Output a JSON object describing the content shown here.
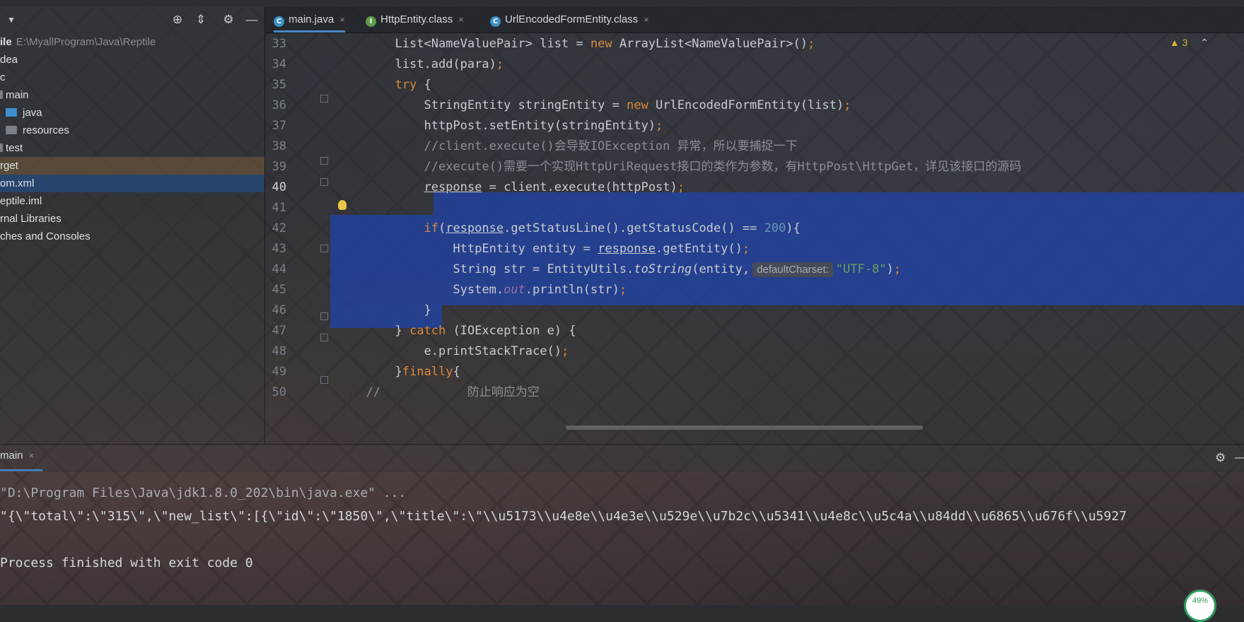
{
  "project": {
    "root_name": "ile",
    "root_path": "E:\\MyallProgram\\Java\\Reptile",
    "items": [
      {
        "label": "dea"
      },
      {
        "label": "c"
      },
      {
        "label": "main"
      },
      {
        "label": "java"
      },
      {
        "label": "resources"
      },
      {
        "label": "test"
      },
      {
        "label": "rget"
      },
      {
        "label": "om.xml"
      },
      {
        "label": "eptile.iml"
      },
      {
        "label": "rnal Libraries"
      },
      {
        "label": "ches and Consoles"
      }
    ]
  },
  "tabs": [
    {
      "label": "main.java",
      "icon": "C",
      "close": "×"
    },
    {
      "label": "HttpEntity.class",
      "icon": "I",
      "close": "×"
    },
    {
      "label": "UrlEncodedFormEntity.class",
      "icon": "C",
      "close": "×"
    }
  ],
  "editor": {
    "warning_count": "3",
    "lines": {
      "n33": "33",
      "n34": "34",
      "n35": "35",
      "n36": "36",
      "n37": "37",
      "n38": "38",
      "n39": "39",
      "n40": "40",
      "n41": "41",
      "n42": "42",
      "n43": "43",
      "n44": "44",
      "n45": "45",
      "n46": "46",
      "n47": "47",
      "n48": "48",
      "n49": "49",
      "n50": "50"
    },
    "code": {
      "l33a": "List<NameValuePair> list = ",
      "l33b": "new",
      "l33c": " ArrayList<NameValuePair>()",
      "l33d": ";",
      "l34a": "list.add(para)",
      "l34b": ";",
      "l35a": "try",
      "l35b": " {",
      "l36a": "StringEntity stringEntity = ",
      "l36b": "new",
      "l36c": " UrlEncodedFormEntity(list)",
      "l36d": ";",
      "l37a": "httpPost.setEntity(stringEntity)",
      "l37b": ";",
      "l38": "//client.execute()会导致IOException 异常，所以要捕捉一下",
      "l39": "//execute()需要一个实现HttpUriRequest接口的类作为参数，有HttpPost\\HttpGet，详见该接口的源码",
      "l40a": "response",
      "l40b": " = client.execute(httpPost)",
      "l40c": ";",
      "l42a": "if",
      "l42b": "(",
      "l42c": "response",
      "l42d": ".getStatusLine().getStatusCode() == ",
      "l42e": "200",
      "l42f": "){",
      "l43a": "HttpEntity entity = ",
      "l43b": "response",
      "l43c": ".getEntity()",
      "l43d": ";",
      "l44a": "String str = EntityUtils.",
      "l44b": "toString",
      "l44c": "(entity,",
      "l44hint": "defaultCharset:",
      "l44d": "\"UTF-8\"",
      "l44e": ")",
      "l44f": ";",
      "l45a": "System.",
      "l45b": "out",
      "l45c": ".println(str)",
      "l45d": ";",
      "l46": "}",
      "l47a": "} ",
      "l47b": "catch",
      "l47c": " (IOException e) {",
      "l48a": "e.printStackTrace()",
      "l48b": ";",
      "l49a": "}",
      "l49b": "finally",
      "l49c": "{",
      "l50": "//            防止响应为空"
    }
  },
  "run": {
    "tab_label": "main",
    "close": "×",
    "console": [
      "\"D:\\Program Files\\Java\\jdk1.8.0_202\\bin\\java.exe\" ...",
      "\"{\\\"total\\\":\\\"315\\\",\\\"new_list\\\":[{\\\"id\\\":\\\"1850\\\",\\\"title\\\":\\\"\\\\u5173\\\\u4e8e\\\\u4e3e\\\\u529e\\\\u7b2c\\\\u5341\\\\u4e8c\\\\u5c4a\\\\u84dd\\\\u6865\\\\u676f\\\\u5927",
      "",
      "Process finished with exit code 0"
    ]
  },
  "status": {
    "cpu_text": "49%"
  },
  "colors": {
    "keyword": "#d88a3e",
    "number": "#6897bb",
    "string": "#6a9f5c",
    "comment": "#8b8f95",
    "selection": "#2142a0",
    "accent": "#4a88c7"
  }
}
